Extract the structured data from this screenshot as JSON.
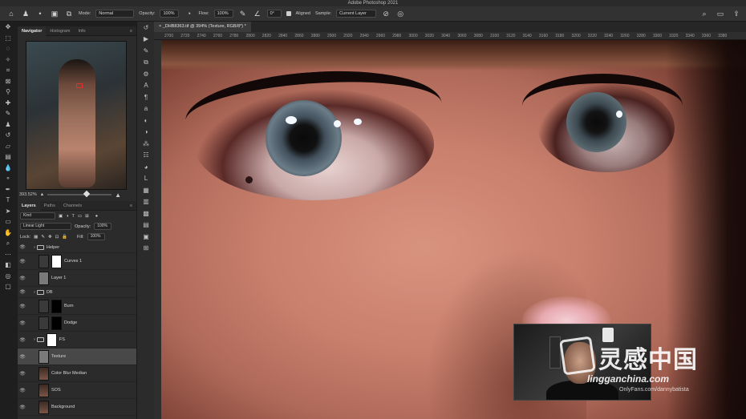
{
  "app": {
    "title": "Adobe Photoshop 2021"
  },
  "options": {
    "mode_label": "Mode:",
    "mode_value": "Normal",
    "opacity_label": "Opacity:",
    "opacity_value": "100%",
    "flow_label": "Flow:",
    "flow_value": "100%",
    "angle_value": "0°",
    "aligned_label": "Aligned",
    "sample_label": "Sample:",
    "sample_value": "Current Layer"
  },
  "navigator": {
    "tabs": [
      "Navigator",
      "Histogram",
      "Info"
    ],
    "zoom": "393.52%",
    "zoom_level": 0.62
  },
  "layers": {
    "tabs": [
      "Layers",
      "Paths",
      "Channels"
    ],
    "filter_kind": "Kind",
    "blend_mode": "Linear Light",
    "opacity_label": "Opacity:",
    "opacity_value": "100%",
    "lock_label": "Lock:",
    "fill_label": "Fill:",
    "fill_value": "100%",
    "rows": [
      {
        "name": "Helper",
        "kind": "group"
      },
      {
        "name": "Curves 1",
        "kind": "adjust-white"
      },
      {
        "name": "Layer 1",
        "kind": "gray"
      },
      {
        "name": "DB",
        "kind": "group"
      },
      {
        "name": "Burn",
        "kind": "adjust-black"
      },
      {
        "name": "Dodge",
        "kind": "adjust-black"
      },
      {
        "name": "FS",
        "kind": "group-mask"
      },
      {
        "name": "Texture",
        "kind": "gray"
      },
      {
        "name": "Color Blur Median",
        "kind": "photo"
      },
      {
        "name": "SOS",
        "kind": "photo"
      },
      {
        "name": "Background",
        "kind": "photo"
      }
    ]
  },
  "document": {
    "tab_label": "_DHB8363.tif @ 394% (Texture, RGB/8*) *",
    "ruler_ticks": [
      "2700",
      "2720",
      "2740",
      "2760",
      "2780",
      "2800",
      "2820",
      "2840",
      "2860",
      "2880",
      "2900",
      "2920",
      "2940",
      "2960",
      "2980",
      "3000",
      "3020",
      "3040",
      "3060",
      "3080",
      "3100",
      "3120",
      "3140",
      "3160",
      "3180",
      "3200",
      "3220",
      "3240",
      "3260",
      "3280",
      "3300",
      "3320",
      "3340",
      "3360",
      "3380"
    ]
  },
  "watermark": {
    "chinese": "灵感中国",
    "english": "lingganchina.com",
    "sub": "OnlyFans.com/dannybatista"
  },
  "colors": {
    "panel_bg": "#2b2b2b",
    "app_bg": "#1e1e1e",
    "selected_layer": "#484848"
  }
}
